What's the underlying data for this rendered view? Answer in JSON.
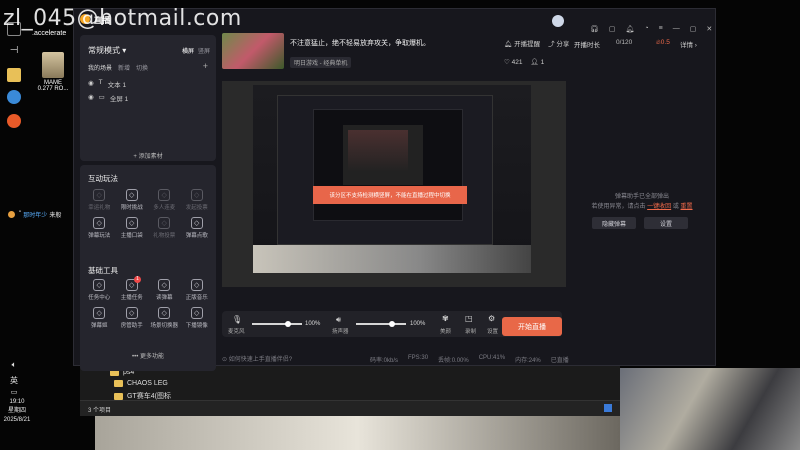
{
  "watermark": "zl_045@hotmail.com",
  "desktop": {
    "accelerate_label": ".accelerate",
    "mame_icon": {
      "line1": "MAME",
      "line2": "0.277 RO..."
    },
    "chat_preview": {
      "prefix": "'' ",
      "name": "那时年少",
      "message": "来般"
    }
  },
  "taskbar": {
    "ime_lang": "英",
    "time": "19:10",
    "weekday": "星期四",
    "date": "2025/8/21"
  },
  "explorer": {
    "items": [
      "ps4",
      "CHAOS LEG",
      "GT赛车4(图标"
    ],
    "status_text": "3 个项目"
  },
  "app": {
    "logo_text": "直播",
    "mode_label": "常规模式",
    "orientation": {
      "landscape": "横屏",
      "portrait": "竖屏"
    },
    "scenes": {
      "title": "我的场景",
      "action1": "新增",
      "action2": "切换"
    },
    "sources": [
      {
        "name": "文本 1"
      },
      {
        "name": "全屏 1"
      }
    ],
    "add_source": "添加素材",
    "interactive": {
      "title": "互动玩法",
      "items": [
        {
          "label": "幸运礼物",
          "icon": "gift-icon",
          "dim": true
        },
        {
          "label": "限时挑战",
          "icon": "shield-icon",
          "dim": false
        },
        {
          "label": "多人连麦",
          "icon": "link-icon",
          "dim": true
        },
        {
          "label": "发起投票",
          "icon": "vote-icon",
          "dim": true
        },
        {
          "label": "弹幕玩法",
          "icon": "danmaku-icon",
          "dim": false
        },
        {
          "label": "主播口袋",
          "icon": "pocket-icon",
          "dim": false
        },
        {
          "label": "礼物投票",
          "icon": "gift-vote-icon",
          "dim": true
        },
        {
          "label": "弹幕点歌",
          "icon": "music-icon",
          "dim": false
        }
      ]
    },
    "tools": {
      "title": "基础工具",
      "items": [
        {
          "label": "任务中心",
          "icon": "task-icon",
          "badge": ""
        },
        {
          "label": "主播任务",
          "icon": "ad-icon",
          "badge": "1"
        },
        {
          "label": "读弹幕",
          "icon": "read-danmaku-icon",
          "badge": ""
        },
        {
          "label": "正版音乐",
          "icon": "music-note-icon",
          "badge": ""
        },
        {
          "label": "弹幕姬",
          "icon": "danmaku-box-icon",
          "badge": ""
        },
        {
          "label": "房管助手",
          "icon": "manager-icon",
          "badge": ""
        },
        {
          "label": "场景切换器",
          "icon": "scene-switch-icon",
          "badge": ""
        },
        {
          "label": "下播镜像",
          "icon": "mirror-icon",
          "badge": ""
        }
      ],
      "more": "更多功能"
    },
    "stream_info": {
      "title": "不注意猛止，绝不轻易放弃攻关，争取爆机。",
      "category": "明日游戏 - 经典单机",
      "actions": [
        "开播提醒",
        "分享"
      ],
      "stats": {
        "likes": "421",
        "count": "1"
      }
    },
    "preview_toast": "该分区不支持检测横竖屏，不能在直播过程中切换",
    "controls": {
      "mic_label": "麦克风",
      "mic_volume": "100%",
      "mic_level": 0.72,
      "speaker_label": "扬声器",
      "speaker_volume": "100%",
      "speaker_level": 0.72,
      "buttons": [
        "美颜",
        "录制",
        "设置"
      ],
      "go_live": "开始直播"
    },
    "footer": {
      "tip": "如何快速上手直播伴侣?",
      "stats": [
        "码率:0kb/s",
        "FPS:30",
        "丢帧:0.00%",
        "CPU:41%",
        "内存:24%",
        "已直播"
      ]
    },
    "right_panel": {
      "time_label": "开播时长",
      "counter": "0/120",
      "heat": "0.5",
      "detail": "详情",
      "notice_line1": "弹幕助手已全部弹出",
      "notice_line2_prefix": "若使用异常，请点击",
      "notice_link1": "一键收回",
      "notice_or": "或",
      "notice_link2": "重置",
      "hide_button": "隐藏弹幕",
      "settings_button": "设置"
    }
  }
}
